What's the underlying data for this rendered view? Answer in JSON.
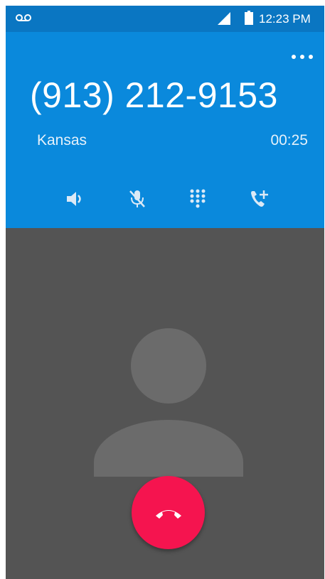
{
  "status_bar": {
    "time": "12:23 PM",
    "icons": [
      "voicemail-icon",
      "signal-icon",
      "battery-icon"
    ]
  },
  "call": {
    "number": "(913) 212-9153",
    "location": "Kansas",
    "duration": "00:25"
  },
  "controls": [
    {
      "name": "speaker-icon"
    },
    {
      "name": "mute-icon"
    },
    {
      "name": "dialpad-icon"
    },
    {
      "name": "add-call-icon"
    }
  ],
  "end_call": {
    "icon": "end-call-icon",
    "color": "#f5144f"
  },
  "colors": {
    "header": "#0a89dc",
    "status_bar": "#0a76c2",
    "background": "#545454",
    "avatar": "#6b6b6b"
  }
}
